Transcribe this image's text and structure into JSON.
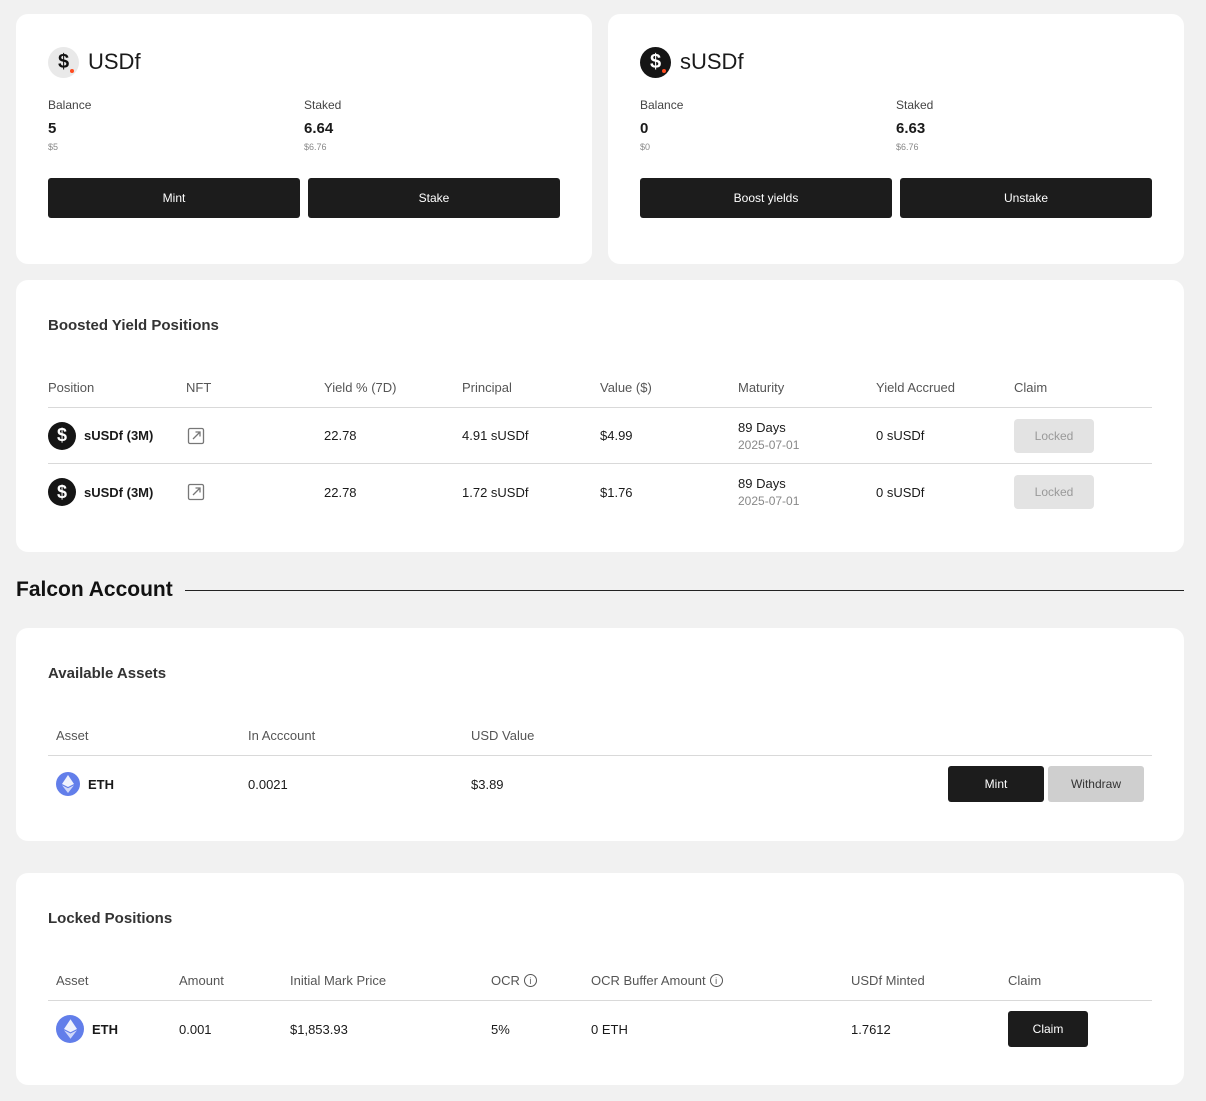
{
  "usdf_card": {
    "name": "USDf",
    "balance_label": "Balance",
    "balance_value": "5",
    "balance_usd": "$5",
    "staked_label": "Staked",
    "staked_value": "6.64",
    "staked_usd": "$6.76",
    "btn_mint": "Mint",
    "btn_stake": "Stake"
  },
  "susdf_card": {
    "name": "sUSDf",
    "balance_label": "Balance",
    "balance_value": "0",
    "balance_usd": "$0",
    "staked_label": "Staked",
    "staked_value": "6.63",
    "staked_usd": "$6.76",
    "btn_boost": "Boost yields",
    "btn_unstake": "Unstake"
  },
  "boosted": {
    "title": "Boosted Yield Positions",
    "headers": [
      "Position",
      "NFT",
      "Yield % (7D)",
      "Principal",
      "Value ($)",
      "Maturity",
      "Yield Accrued",
      "Claim"
    ],
    "rows": [
      {
        "position": "sUSDf (3M)",
        "yield": "22.78",
        "principal": "4.91 sUSDf",
        "value": "$4.99",
        "maturity_days": "89 Days",
        "maturity_date": "2025-07-01",
        "accrued": "0 sUSDf",
        "claim": "Locked"
      },
      {
        "position": "sUSDf (3M)",
        "yield": "22.78",
        "principal": "1.72 sUSDf",
        "value": "$1.76",
        "maturity_days": "89 Days",
        "maturity_date": "2025-07-01",
        "accrued": "0 sUSDf",
        "claim": "Locked"
      }
    ]
  },
  "falcon_heading": "Falcon Account",
  "available": {
    "title": "Available Assets",
    "headers": [
      "Asset",
      "In Acccount",
      "USD Value"
    ],
    "rows": [
      {
        "asset": "ETH",
        "in_account": "0.0021",
        "usd_value": "$3.89",
        "btn_mint": "Mint",
        "btn_withdraw": "Withdraw"
      }
    ]
  },
  "locked": {
    "title": "Locked Positions",
    "headers": [
      "Asset",
      "Amount",
      "Initial Mark Price",
      "OCR",
      "OCR Buffer Amount",
      "USDf Minted",
      "Claim"
    ],
    "rows": [
      {
        "asset": "ETH",
        "amount": "0.001",
        "mark_price": "$1,853.93",
        "ocr": "5%",
        "buffer": "0 ETH",
        "minted": "1.7612",
        "claim": "Claim"
      }
    ]
  },
  "colors": {
    "page_bg": "#f1f1f1",
    "card_bg": "#ffffff",
    "primary_button": "#1c1c1c",
    "disabled_button": "#e3e3e3",
    "eth_blue": "#627eea",
    "coin_accent": "#ff4b1f"
  },
  "icons": [
    "usdf-coin-icon",
    "susdf-coin-icon",
    "external-link-icon",
    "eth-icon",
    "info-icon"
  ]
}
